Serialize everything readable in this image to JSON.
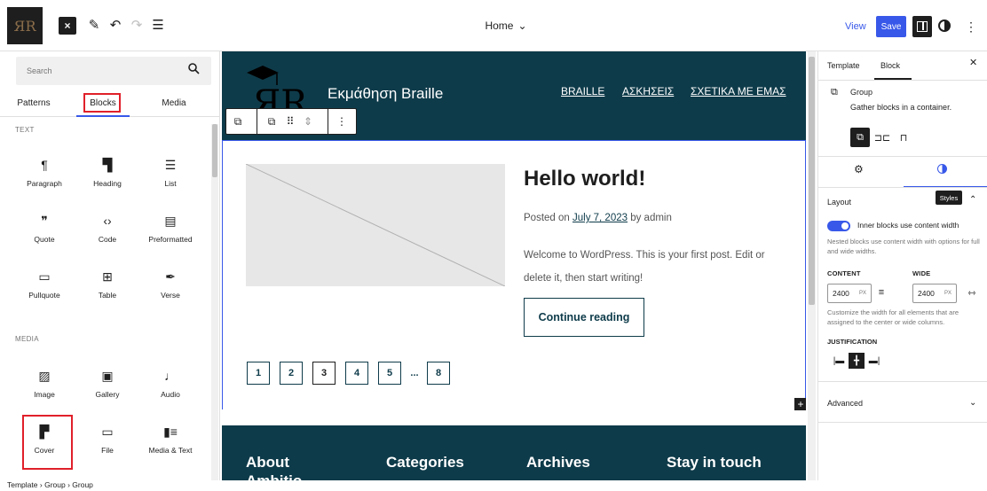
{
  "topbar": {
    "logo_text": "ЯR",
    "close_icon": "×",
    "document_title": "Home",
    "view_label": "View",
    "save_label": "Save"
  },
  "inserter": {
    "search_placeholder": "Search",
    "tabs": [
      "Patterns",
      "Blocks",
      "Media"
    ],
    "categories": {
      "text": "TEXT",
      "media": "MEDIA"
    },
    "text_blocks": [
      {
        "label": "Paragraph",
        "icon": "¶"
      },
      {
        "label": "Heading",
        "icon": "▜"
      },
      {
        "label": "List",
        "icon": "☰"
      },
      {
        "label": "Quote",
        "icon": "❞"
      },
      {
        "label": "Code",
        "icon": "‹›"
      },
      {
        "label": "Preformatted",
        "icon": "▤"
      },
      {
        "label": "Pullquote",
        "icon": "▭"
      },
      {
        "label": "Table",
        "icon": "⊞"
      },
      {
        "label": "Verse",
        "icon": "✒"
      }
    ],
    "media_blocks": [
      {
        "label": "Image",
        "icon": "▨"
      },
      {
        "label": "Gallery",
        "icon": "▣"
      },
      {
        "label": "Audio",
        "icon": "♩"
      },
      {
        "label": "Cover",
        "icon": "▛"
      },
      {
        "label": "File",
        "icon": "▭"
      },
      {
        "label": "Media & Text",
        "icon": "▮≡"
      }
    ]
  },
  "canvas": {
    "site_title": "Εκμάθηση Braille",
    "nav": [
      "BRAILLE",
      "ΑΣΚΗΣΕΙΣ",
      "ΣΧΕΤΙΚΑ ΜΕ ΕΜΑΣ"
    ],
    "post_title": "Hello world!",
    "meta_prefix": "Posted on",
    "meta_date": "July 7, 2023",
    "meta_by": "by admin",
    "excerpt": "Welcome to WordPress. This is your first post. Edit or delete it, then start writing!",
    "continue_label": "Continue reading",
    "pagination": [
      "1",
      "2",
      "3",
      "4",
      "5",
      "...",
      "8"
    ],
    "current_page": "3",
    "footer_headings": [
      "About",
      "Categories",
      "Archives",
      "Stay in touch"
    ],
    "footer_partial": "Ambitio"
  },
  "sidebar": {
    "tabs": [
      "Template",
      "Block"
    ],
    "block_name": "Group",
    "block_desc": "Gather blocks in a container.",
    "styles_tooltip": "Styles",
    "layout_title": "Layout",
    "toggle_label": "Inner blocks use content width",
    "toggle_on": true,
    "toggle_help": "Nested blocks use content width with options for full and wide widths.",
    "content_label": "CONTENT",
    "wide_label": "WIDE",
    "content_value": "2400",
    "wide_value": "2400",
    "unit": "PX",
    "width_help": "Customize the width for all elements that are assigned to the center or wide columns.",
    "justification_label": "JUSTIFICATION",
    "advanced_title": "Advanced"
  },
  "breadcrumb": [
    "Template",
    "Group",
    "Group"
  ],
  "colors": {
    "accent": "#3858e9",
    "site_dark": "#0e3b4a",
    "highlight": "#e0202a"
  }
}
